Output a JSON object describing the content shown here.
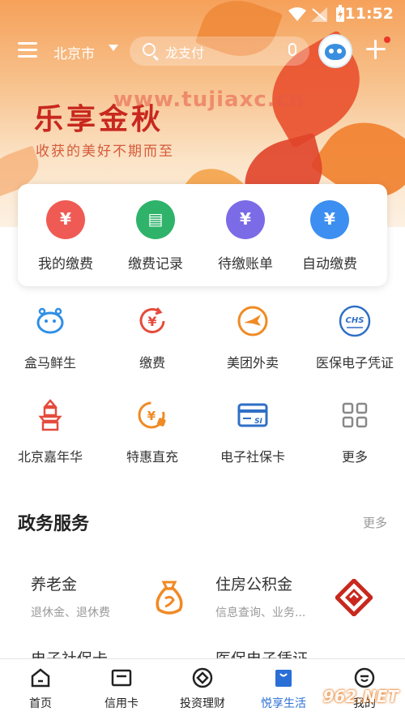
{
  "status_bar": {
    "time": "11:52"
  },
  "top_nav": {
    "city": "北京市",
    "search_placeholder": "龙支付"
  },
  "banner": {
    "title": "乐享金秋",
    "subtitle": "收获的美好不期而至",
    "watermark": "www.tujiaxc.cn"
  },
  "payment_card": [
    {
      "label": "我的缴费",
      "icon": "wallet-yen-icon",
      "color": "#ef5b54"
    },
    {
      "label": "缴费记录",
      "icon": "clipboard-icon",
      "color": "#2fb36a"
    },
    {
      "label": "待缴账单",
      "icon": "bill-yen-icon",
      "color": "#7b6be6"
    },
    {
      "label": "自动缴费",
      "icon": "monitor-yen-icon",
      "color": "#3c8ff0"
    }
  ],
  "services": [
    {
      "label": "盒马鲜生",
      "icon": "hippo-icon"
    },
    {
      "label": "缴费",
      "icon": "yen-refresh-icon"
    },
    {
      "label": "美团外卖",
      "icon": "kangaroo-icon"
    },
    {
      "label": "医保电子凭证",
      "icon": "chs-badge-icon"
    },
    {
      "label": "北京嘉年华",
      "icon": "pagoda-icon"
    },
    {
      "label": "特惠直充",
      "icon": "yen-tag-icon"
    },
    {
      "label": "电子社保卡",
      "icon": "si-card-icon"
    },
    {
      "label": "更多",
      "icon": "grid-four-icon"
    }
  ],
  "gov_services": {
    "title": "政务服务",
    "more": "更多",
    "items": [
      {
        "title": "养老金",
        "subtitle": "退休金、退休费",
        "icon": "money-bag-icon"
      },
      {
        "title": "住房公积金",
        "subtitle": "信息查询、业务...",
        "icon": "housing-fund-icon"
      },
      {
        "title": "电子社保卡",
        "subtitle": ""
      },
      {
        "title": "医保电子凭证",
        "subtitle": ""
      }
    ]
  },
  "tabbar": [
    {
      "label": "首页",
      "icon": "home-icon",
      "active": false
    },
    {
      "label": "信用卡",
      "icon": "credit-card-icon",
      "active": false
    },
    {
      "label": "投资理财",
      "icon": "investment-icon",
      "active": false
    },
    {
      "label": "悦享生活",
      "icon": "lifestyle-bag-icon",
      "active": true
    },
    {
      "label": "我的",
      "icon": "profile-icon",
      "active": false
    }
  ],
  "watermark_corner": "962.NET"
}
